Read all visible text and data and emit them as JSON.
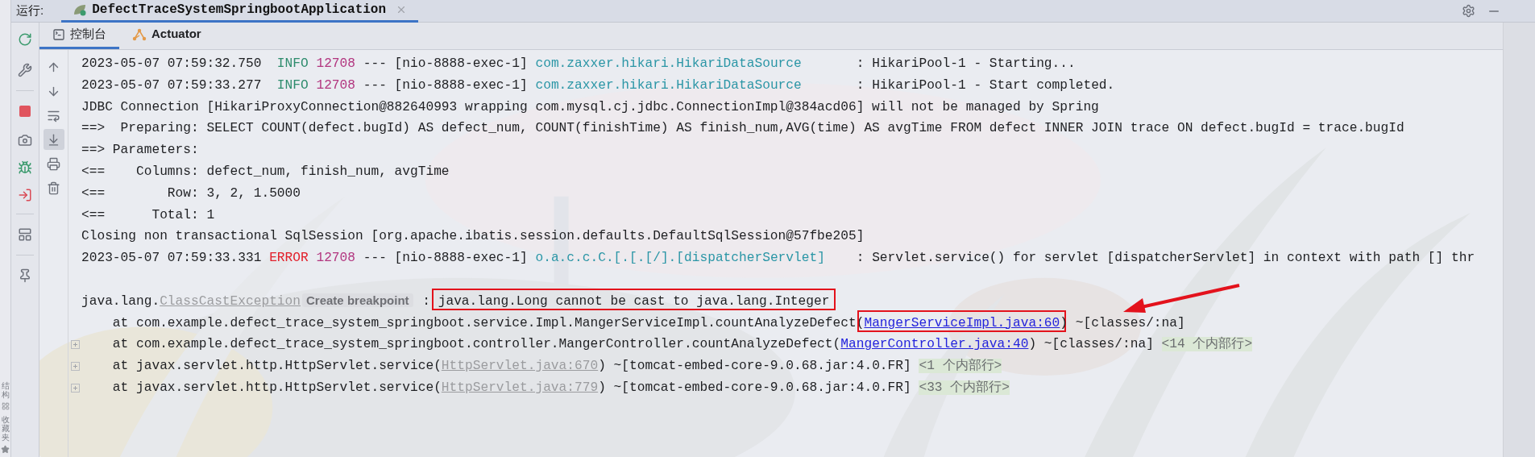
{
  "run_bar": {
    "label": "运行:",
    "tabs": [
      {
        "title": "DefectTraceSystemSpringbootApplication",
        "selected": true
      }
    ]
  },
  "console_tabs": [
    {
      "label": "控制台",
      "kind": "console",
      "selected": true
    },
    {
      "label": "Actuator",
      "kind": "actuator",
      "selected": false
    }
  ],
  "left_toolbar": [
    {
      "kind": "rerun"
    },
    {
      "kind": "wrench"
    },
    {
      "kind": "separator"
    },
    {
      "kind": "stop"
    },
    {
      "kind": "camera"
    },
    {
      "kind": "bug"
    },
    {
      "kind": "import"
    },
    {
      "kind": "separator"
    },
    {
      "kind": "layout"
    },
    {
      "kind": "separator"
    },
    {
      "kind": "pin"
    }
  ],
  "console_toolbar": [
    {
      "kind": "up",
      "selected": false
    },
    {
      "kind": "down",
      "selected": false
    },
    {
      "kind": "wrap",
      "selected": false
    },
    {
      "kind": "scroll_end",
      "selected": true
    },
    {
      "kind": "print",
      "selected": false
    },
    {
      "kind": "trash",
      "selected": false
    }
  ],
  "side_labels": [
    {
      "text": "结构",
      "kind": "structure"
    },
    {
      "text": "收藏夹",
      "kind": "star"
    }
  ],
  "lines": [
    {
      "collapsed": false,
      "segments": [
        {
          "kind": "plain",
          "text": "2023-05-07 07:59:32.750  "
        },
        {
          "kind": "info",
          "text": "INFO"
        },
        {
          "kind": "pid",
          "text": "12708"
        },
        {
          "kind": "plain",
          "text": " --- [nio-8888-exec-1] "
        },
        {
          "kind": "logger",
          "text": "com.zaxxer.hikari.HikariDataSource"
        },
        {
          "kind": "plain",
          "text": "       : HikariPool-1 - Starting..."
        }
      ]
    },
    {
      "collapsed": false,
      "segments": [
        {
          "kind": "plain",
          "text": "2023-05-07 07:59:33.277  "
        },
        {
          "kind": "info",
          "text": "INFO"
        },
        {
          "kind": "pid",
          "text": "12708"
        },
        {
          "kind": "plain",
          "text": " --- [nio-8888-exec-1] "
        },
        {
          "kind": "logger",
          "text": "com.zaxxer.hikari.HikariDataSource"
        },
        {
          "kind": "plain",
          "text": "       : HikariPool-1 - Start completed."
        }
      ]
    },
    {
      "collapsed": false,
      "segments": [
        {
          "kind": "plain",
          "text": "JDBC Connection [HikariProxyConnection@882640993 wrapping com.mysql.cj.jdbc.ConnectionImpl@384acd06] will not be managed by Spring"
        }
      ]
    },
    {
      "collapsed": false,
      "segments": [
        {
          "kind": "plain",
          "text": "==>  Preparing: SELECT COUNT(defect.bugId) AS defect_num, COUNT(finishTime) AS finish_num,AVG(time) AS avgTime FROM defect INNER JOIN trace ON defect.bugId = trace.bugId"
        }
      ]
    },
    {
      "collapsed": false,
      "segments": [
        {
          "kind": "plain",
          "text": "==> Parameters:"
        }
      ]
    },
    {
      "collapsed": false,
      "segments": [
        {
          "kind": "plain",
          "text": "<==    Columns: defect_num, finish_num, avgTime"
        }
      ]
    },
    {
      "collapsed": false,
      "segments": [
        {
          "kind": "plain",
          "text": "<==        Row: 3, 2, 1.5000"
        }
      ]
    },
    {
      "collapsed": false,
      "segments": [
        {
          "kind": "plain",
          "text": "<==      Total: 1"
        }
      ]
    },
    {
      "collapsed": false,
      "segments": [
        {
          "kind": "plain",
          "text": "Closing non transactional SqlSession [org.apache.ibatis.session.defaults.DefaultSqlSession@57fbe205]"
        }
      ]
    },
    {
      "collapsed": false,
      "segments": [
        {
          "kind": "plain",
          "text": "2023-05-07 07:59:33.331 "
        },
        {
          "kind": "error",
          "text": "ERROR"
        },
        {
          "kind": "pid",
          "text": "12708"
        },
        {
          "kind": "plain",
          "text": " --- [nio-8888-exec-1] "
        },
        {
          "kind": "logger",
          "text": "o.a.c.c.C.[.[.[/].[dispatcherServlet]"
        },
        {
          "kind": "plain",
          "text": "    : Servlet.service() for servlet [dispatcherServlet] in context with path [] thr"
        }
      ]
    },
    {
      "collapsed": false
    },
    {
      "collapsed": false,
      "segments": [
        {
          "kind": "plain",
          "text": "java.lang."
        },
        {
          "kind": "dim_link",
          "text": "ClassCastException"
        },
        {
          "kind": "badge",
          "text": "Create breakpoint"
        },
        {
          "kind": "plain",
          "text": " : "
        },
        {
          "kind": "plain",
          "text": "java.lang.Long cannot be cast to java.lang.Integer",
          "annotated": true
        }
      ]
    },
    {
      "collapsed": false,
      "segments": [
        {
          "kind": "plain",
          "text": "    at com.example.defect_trace_system_springboot.service.Impl.MangerServiceImpl.countAnalyzeDefect("
        },
        {
          "kind": "link",
          "text": "MangerServiceImpl.java:60",
          "annotated": true
        },
        {
          "kind": "plain",
          "text": ") ~[classes/:na]"
        }
      ]
    },
    {
      "collapsed": true,
      "segments": [
        {
          "kind": "plain",
          "text": "    at com.example.defect_trace_system_springboot.controller.MangerController.countAnalyzeDefect("
        },
        {
          "kind": "link",
          "text": "MangerController.java:40"
        },
        {
          "kind": "plain",
          "text": ") ~[classes/:na] "
        },
        {
          "kind": "hint",
          "text": "<14 个内部行>"
        }
      ]
    },
    {
      "collapsed": true,
      "segments": [
        {
          "kind": "plain",
          "text": "    at javax.servlet.http.HttpServlet.service("
        },
        {
          "kind": "dim_link",
          "text": "HttpServlet.java:670"
        },
        {
          "kind": "plain",
          "text": ") ~[tomcat-embed-core-9.0.68.jar:4.0.FR] "
        },
        {
          "kind": "hint",
          "text": "<1 个内部行>"
        }
      ]
    },
    {
      "collapsed": true,
      "segments": [
        {
          "kind": "plain",
          "text": "    at javax.servlet.http.HttpServlet.service("
        },
        {
          "kind": "dim_link",
          "text": "HttpServlet.java:779"
        },
        {
          "kind": "plain",
          "text": ") ~[tomcat-embed-core-9.0.68.jar:4.0.FR] "
        },
        {
          "kind": "hint",
          "text": "<33 个内部行>"
        }
      ]
    }
  ]
}
